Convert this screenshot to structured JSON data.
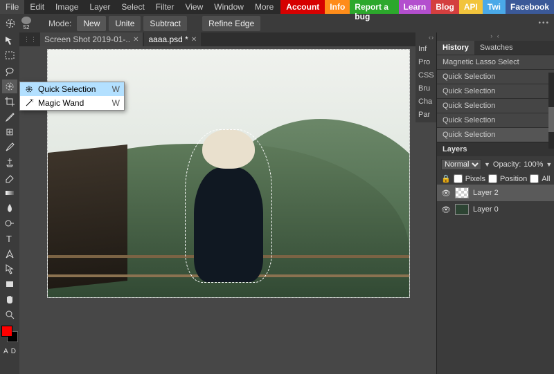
{
  "menubar": {
    "items": [
      "File",
      "Edit",
      "Image",
      "Layer",
      "Select",
      "Filter",
      "View",
      "Window",
      "More"
    ],
    "account": "Account",
    "links": {
      "info": "Info",
      "bug": "Report a bug",
      "learn": "Learn",
      "blog": "Blog",
      "api": "API",
      "twi": "Twi",
      "fb": "Facebook"
    }
  },
  "optbar": {
    "brush_size": "52",
    "mode_label": "Mode:",
    "new": "New",
    "unite": "Unite",
    "subtract": "Subtract",
    "refine": "Refine Edge"
  },
  "doctabs": {
    "tabs": [
      {
        "label": "Screen Shot 2019-01-..",
        "active": false
      },
      {
        "label": "aaaa.psd *",
        "active": true
      }
    ]
  },
  "tool_flyout": {
    "items": [
      {
        "label": "Quick Selection",
        "shortcut": "W",
        "selected": true,
        "icon": "quick-selection-icon"
      },
      {
        "label": "Magic Wand",
        "shortcut": "W",
        "selected": false,
        "icon": "magic-wand-icon"
      }
    ]
  },
  "collapsed_panels": [
    "Inf",
    "Pro",
    "CSS",
    "Bru",
    "Cha",
    "Par"
  ],
  "history_panel": {
    "tabs": [
      "History",
      "Swatches"
    ],
    "active_tab": "History",
    "items": [
      "Magnetic Lasso Select",
      "Quick Selection",
      "Quick Selection",
      "Quick Selection",
      "Quick Selection",
      "Quick Selection"
    ],
    "selected_index": 5
  },
  "layers_panel": {
    "title": "Layers",
    "blend_mode": "Normal",
    "opacity_label": "Opacity:",
    "opacity_value": "100%",
    "locks": {
      "pixels": "Pixels",
      "position": "Position",
      "all": "All"
    },
    "layers": [
      {
        "name": "Layer 2",
        "visible": true
      },
      {
        "name": "Layer 0",
        "visible": true
      }
    ]
  },
  "swatches": {
    "fg": "#ff0000",
    "bg": "#000000"
  },
  "footer": {
    "a": "A",
    "d": "D"
  }
}
